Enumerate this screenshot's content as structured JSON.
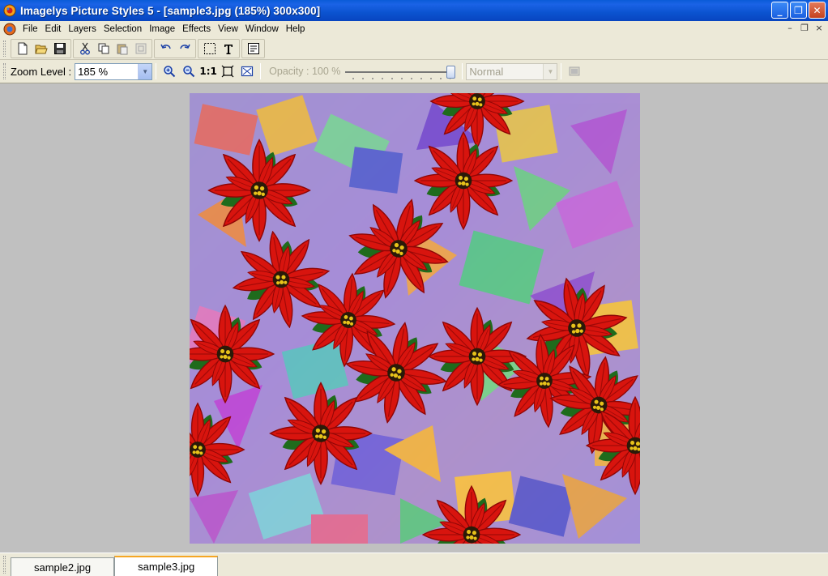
{
  "window": {
    "title": "Imagelys Picture Styles 5 - [sample3.jpg (185%) 300x300]",
    "minimize": "_",
    "maximize": "❐",
    "close": "✕"
  },
  "menu": {
    "items": [
      "File",
      "Edit",
      "Layers",
      "Selection",
      "Image",
      "Effects",
      "View",
      "Window",
      "Help"
    ]
  },
  "mdi": {
    "minimize": "–",
    "restore": "❐",
    "close": "×"
  },
  "toolbar2": {
    "zoom_label": "Zoom Level :",
    "zoom_value": "185 %",
    "one_to_one": "1:1",
    "opacity_label": "Opacity : 100 %",
    "opacity_level": 1.0,
    "blend_mode": "Normal"
  },
  "tabs": [
    {
      "label": "sample2.jpg",
      "active": false
    },
    {
      "label": "sample3.jpg",
      "active": true
    }
  ],
  "colors": {
    "titlebar": "#0a5bd8",
    "workspace": "#c0c0c0",
    "flower_red": "#d8140e",
    "tab_accent": "#f5a623"
  },
  "icons": [
    "new-icon",
    "open-icon",
    "save-icon",
    "cut-icon",
    "copy-icon",
    "paste-icon",
    "paste-disabled-icon",
    "undo-icon",
    "redo-icon",
    "selection-icon",
    "text-icon",
    "properties-icon",
    "zoom-in-icon",
    "zoom-out-icon",
    "fit-icon",
    "fit-window-icon",
    "layer-disabled-icon"
  ]
}
